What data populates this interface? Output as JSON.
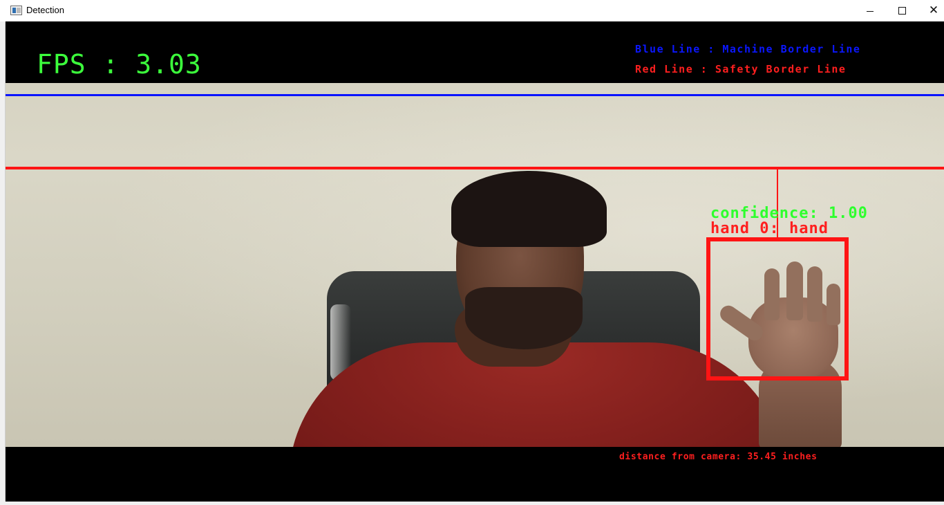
{
  "window": {
    "title": "Detection",
    "controls": {
      "minimize_icon": "minimize-icon",
      "maximize_icon": "maximize-icon",
      "close_icon": "close-icon",
      "close_glyph": "✕"
    }
  },
  "overlay": {
    "fps_text": "FPS : 3.03",
    "legend_blue": "Blue Line : Machine Border Line",
    "legend_red": "Red Line : Safety Border Line",
    "detection": {
      "confidence_text": "confidence: 1.00",
      "label_text": "hand 0: hand"
    },
    "distance_text": "distance from camera: 35.45 inches"
  },
  "colors": {
    "fps": "#3cff3c",
    "machine_border": "#0a14ff",
    "safety_border": "#ff1414",
    "confidence": "#2eff2e",
    "detection_box": "#ff1414"
  }
}
